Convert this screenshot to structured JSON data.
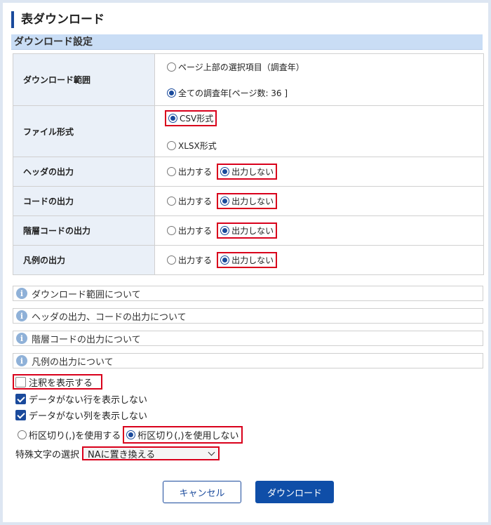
{
  "title": "表ダウンロード",
  "section_heading": "ダウンロード設定",
  "settings": {
    "range": {
      "label": "ダウンロード範囲",
      "options": [
        "ページ上部の選択項目（調査年）",
        "全ての調査年[ページ数: 36 ]"
      ],
      "selected_index": 1
    },
    "format": {
      "label": "ファイル形式",
      "options": [
        "CSV形式",
        "XLSX形式"
      ],
      "selected_index": 0
    },
    "header_output": {
      "label": "ヘッダの出力",
      "options": [
        "出力する",
        "出力しない"
      ],
      "selected_index": 1
    },
    "code_output": {
      "label": "コードの出力",
      "options": [
        "出力する",
        "出力しない"
      ],
      "selected_index": 1
    },
    "hier_code_output": {
      "label": "階層コードの出力",
      "options": [
        "出力する",
        "出力しない"
      ],
      "selected_index": 1
    },
    "legend_output": {
      "label": "凡例の出力",
      "options": [
        "出力する",
        "出力しない"
      ],
      "selected_index": 1
    }
  },
  "info_links": [
    "ダウンロード範囲について",
    "ヘッダの出力、コードの出力について",
    "階層コードの出力について",
    "凡例の出力について"
  ],
  "checkboxes": [
    {
      "label": "注釈を表示する",
      "checked": false
    },
    {
      "label": "データがない行を表示しない",
      "checked": true
    },
    {
      "label": "データがない列を表示しない",
      "checked": true
    }
  ],
  "separator": {
    "options": [
      "桁区切り(,)を使用する",
      "桁区切り(,)を使用しない"
    ],
    "selected_index": 1
  },
  "special_chars": {
    "label": "特殊文字の選択",
    "selected": "NAに置き換える"
  },
  "buttons": {
    "cancel": "キャンセル",
    "download": "ダウンロード"
  },
  "colors": {
    "accent": "#1a4a9c",
    "highlight": "#d9001b",
    "section_bg": "#c9ddf5",
    "label_bg": "#eaf0f8"
  }
}
